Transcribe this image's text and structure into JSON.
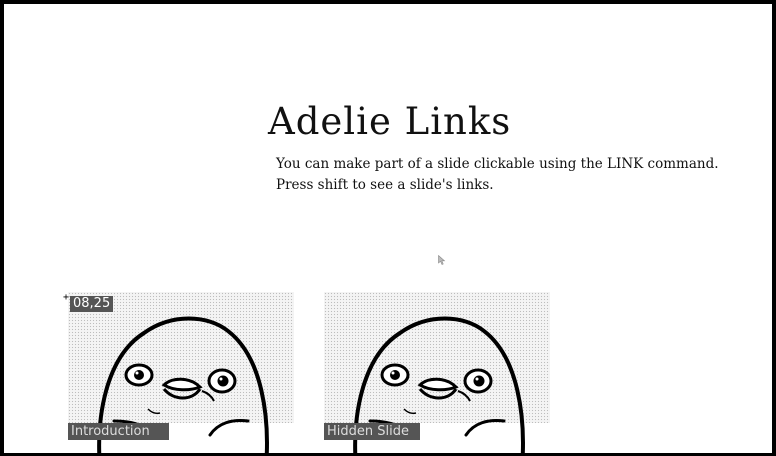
{
  "slide": {
    "title": "Adelie Links",
    "lines": [
      "You can make part of a slide clickable using the LINK command.",
      "Press shift to see a slide's links."
    ]
  },
  "coordinate_readout": "08,25",
  "links": [
    {
      "label": "Introduction",
      "thumbnail_icon": "penguin-icon"
    },
    {
      "label": "Hidden Slide",
      "thumbnail_icon": "penguin-icon"
    }
  ],
  "colors": {
    "frame": "#000000",
    "background": "#ffffff",
    "label_background": "#555555",
    "label_text": "#dddddd"
  }
}
